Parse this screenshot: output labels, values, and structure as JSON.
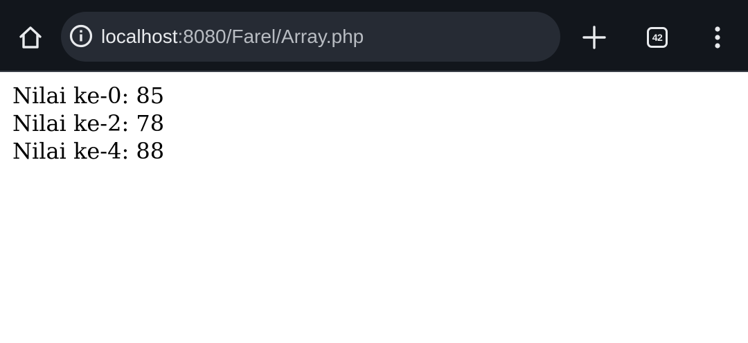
{
  "browser": {
    "url_host": "localhost",
    "url_path": ":8080/Farel/Array.php",
    "tab_count": "42",
    "icons": {
      "home": "home-icon",
      "info": "info-icon",
      "new_tab": "plus-icon",
      "tabs": "tab-switcher-icon",
      "menu": "more-vert-icon"
    },
    "colors": {
      "toolbar_bg": "#12161c",
      "omnibox_bg": "#262b34",
      "icon": "#e8eaed"
    }
  },
  "page": {
    "lines": [
      "Nilai ke-0: 85",
      "Nilai ke-2: 78",
      "Nilai ke-4: 88"
    ]
  }
}
